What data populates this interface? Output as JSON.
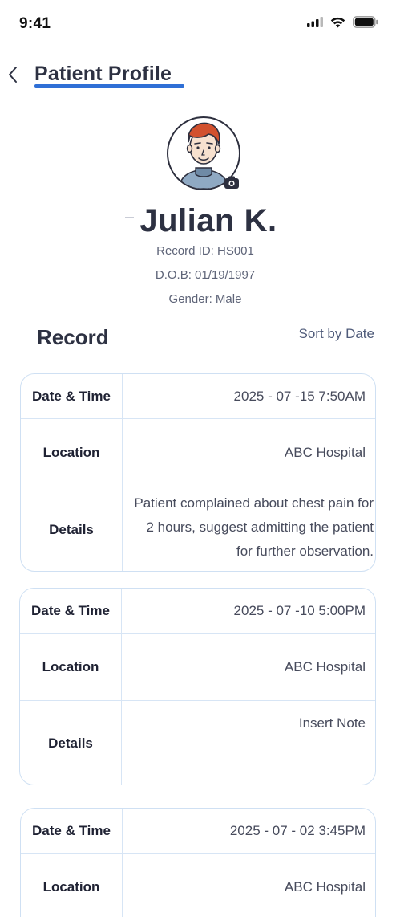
{
  "status_bar": {
    "time": "9:41"
  },
  "header": {
    "title": "Patient Profile"
  },
  "patient": {
    "name": "Julian K.",
    "record_id": "Record ID: HS001",
    "dob": "D.O.B: 01/19/1997",
    "gender": "Gender: Male"
  },
  "records_section": {
    "title": "Record",
    "sort_label": "Sort by Date"
  },
  "labels": {
    "date_time": "Date & Time",
    "location": "Location",
    "details": "Details"
  },
  "records": [
    {
      "date_time": "2025 - 07 -15 7:50AM",
      "location": "ABC Hospital",
      "details": "Patient complained about chest pain for 2 hours, suggest admitting the patient for further observation."
    },
    {
      "date_time": "2025 - 07 -10 5:00PM",
      "location": "ABC Hospital",
      "details": "Insert Note"
    },
    {
      "date_time": "2025 - 07 - 02 3:45PM",
      "location": "ABC Hospital"
    }
  ],
  "colors": {
    "accent": "#2f6fd6",
    "card_border": "#cfe0f3",
    "text_dark": "#2d3142"
  },
  "icons": [
    "signal-icon",
    "wifi-icon",
    "battery-icon",
    "back-arrow-icon",
    "avatar-illustration",
    "camera-icon"
  ]
}
